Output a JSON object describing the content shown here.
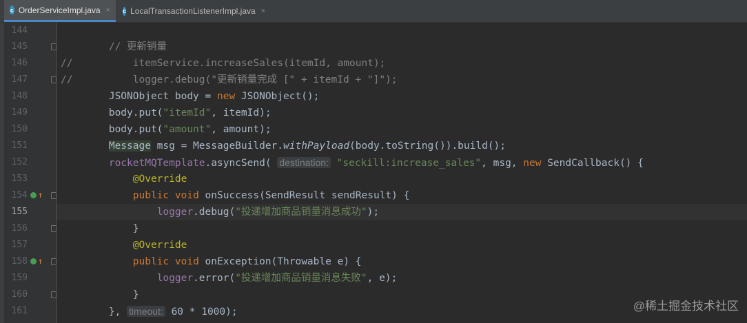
{
  "tabs": [
    {
      "label": "OrderServiceImpl.java",
      "icon": "java-class-icon",
      "active": true
    },
    {
      "label": "LocalTransactionListenerImpl.java",
      "icon": "java-class-icon",
      "active": false
    }
  ],
  "tab_icon_letter": "c",
  "tab_close_glyph": "×",
  "current_line": "155",
  "lines": [
    {
      "n": "144"
    },
    {
      "n": "145",
      "t": [
        "        ",
        "// 更新销量"
      ]
    },
    {
      "n": "146",
      "t": [
        "//          itemService.increaseSales(itemId, amount);"
      ]
    },
    {
      "n": "147",
      "t": [
        "//          logger.debug(\"更新销量完成 [\" + itemId + \"]\");"
      ]
    },
    {
      "n": "148",
      "t": [
        "        JSONObject body = ",
        "new ",
        "JSONObject();"
      ]
    },
    {
      "n": "149",
      "t": [
        "        body.put(",
        "\"itemId\"",
        ", itemId);"
      ]
    },
    {
      "n": "150",
      "t": [
        "        body.put(",
        "\"amount\"",
        ", amount);"
      ]
    },
    {
      "n": "151",
      "t": [
        "        ",
        "Message",
        " msg = MessageBuilder.",
        "withPayload",
        "(body.toString()).build();"
      ]
    },
    {
      "n": "152",
      "t": [
        "        ",
        "rocketMQTemplate",
        ".asyncSend( ",
        "destination:",
        " \"seckill:increase_sales\"",
        ", msg, ",
        "new ",
        "SendCallback() {"
      ]
    },
    {
      "n": "153",
      "t": [
        "            ",
        "@Override"
      ]
    },
    {
      "n": "154",
      "t": [
        "            ",
        "public void ",
        "onSuccess(SendResult sendResult) {"
      ]
    },
    {
      "n": "155",
      "t": [
        "                ",
        "logger",
        ".debug(",
        "\"投递增加商品销量消息成功\"",
        ");"
      ]
    },
    {
      "n": "156",
      "t": [
        "            }"
      ]
    },
    {
      "n": "157",
      "t": [
        "            ",
        "@Override"
      ]
    },
    {
      "n": "158",
      "t": [
        "            ",
        "public void ",
        "onException(Throwable e) {"
      ]
    },
    {
      "n": "159",
      "t": [
        "                ",
        "logger",
        ".error(",
        "\"投递增加商品销量消息失败\"",
        ", e);"
      ]
    },
    {
      "n": "160",
      "t": [
        "            }"
      ]
    },
    {
      "n": "161",
      "t": [
        "        }, ",
        "timeout:",
        " 60 * 1000);"
      ]
    }
  ],
  "watermark": "@稀土掘金技术社区",
  "colors": {
    "background": "#2b2b2b",
    "keyword": "#cc7832",
    "string": "#6a8759",
    "comment": "#808080",
    "annotation": "#bbb529",
    "field": "#9876aa",
    "text": "#a9b7c6"
  }
}
